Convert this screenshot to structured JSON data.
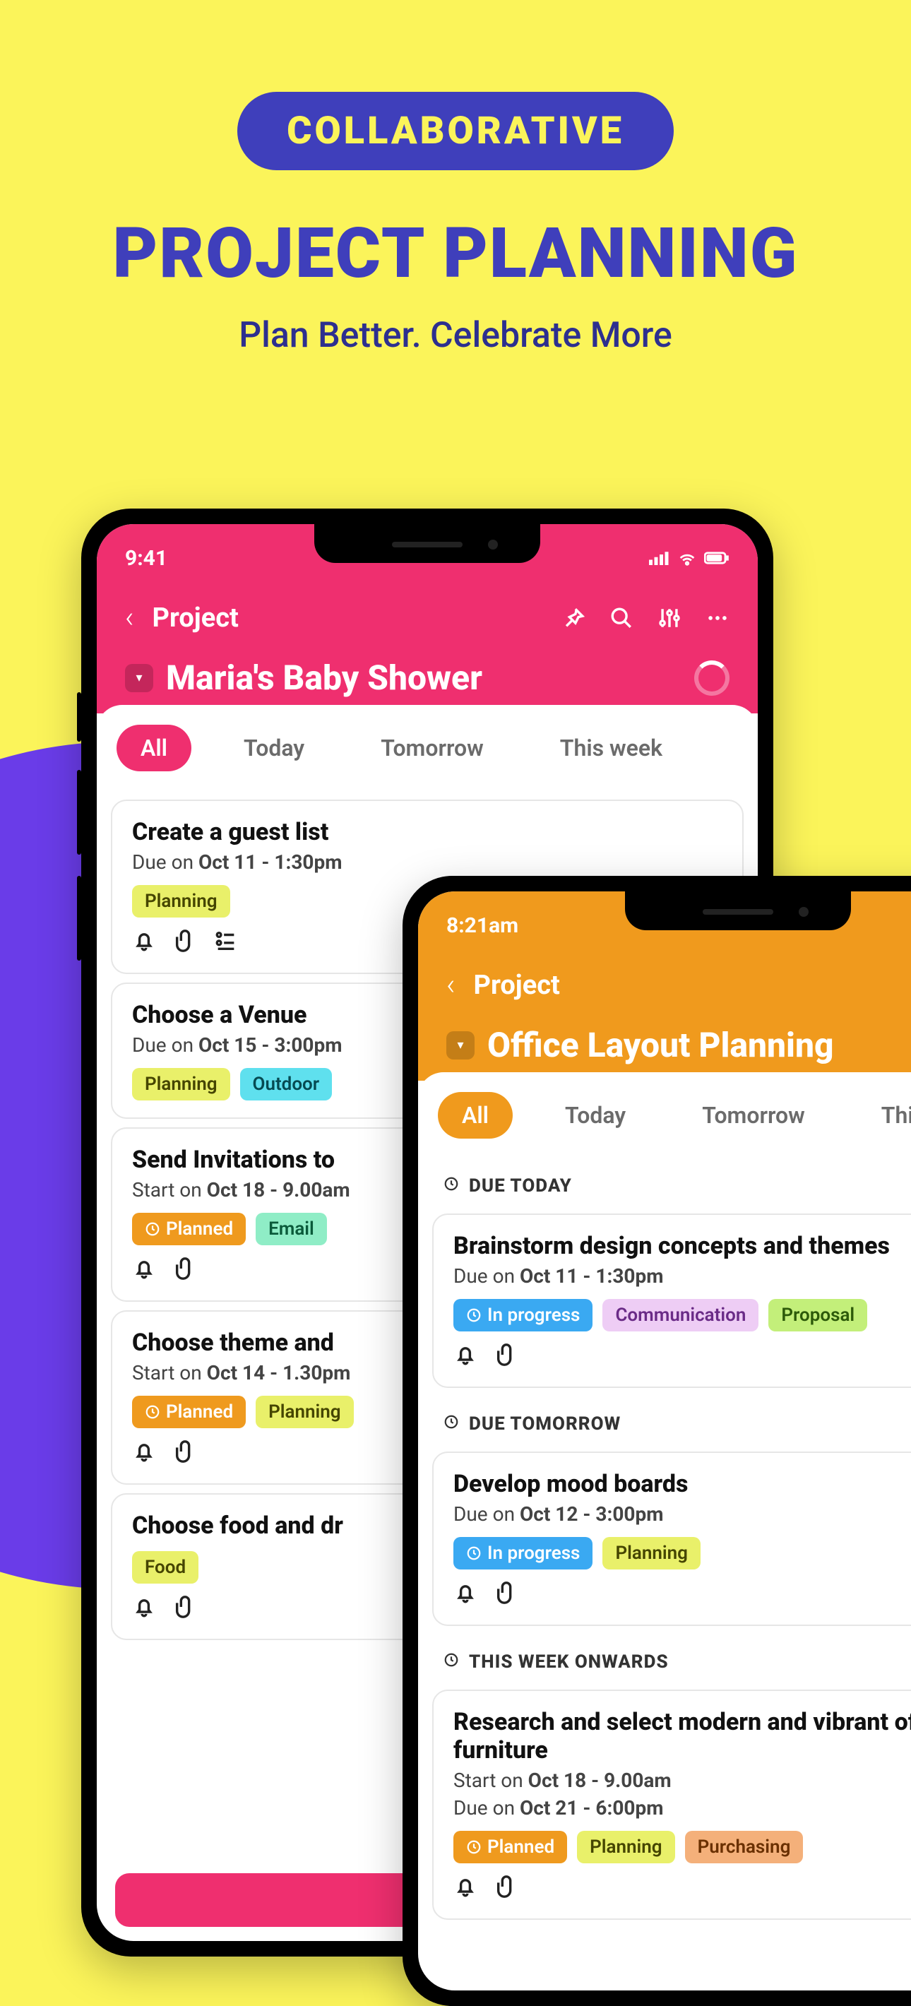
{
  "hero": {
    "pill": "COLLABORATIVE",
    "title": "PROJECT PLANNING",
    "tagline": "Plan Better. Celebrate More"
  },
  "phone1": {
    "time": "9:41",
    "nav_label": "Project",
    "title": "Maria's Baby Shower",
    "filters": {
      "all": "All",
      "today": "Today",
      "tomorrow": "Tomorrow",
      "week": "This week"
    },
    "tasks": [
      {
        "title": "Create a guest list",
        "meta_k": "Due on ",
        "meta_v": "Oct 11 - 1:30pm",
        "tags": [
          {
            "label": "Planning",
            "cls": "yellow"
          }
        ],
        "icons": [
          "bell",
          "clip",
          "list"
        ]
      },
      {
        "title": "Choose a Venue",
        "meta_k": "Due on ",
        "meta_v": "Oct 15 - 3:00pm",
        "tags": [
          {
            "label": "Planning",
            "cls": "yellow"
          },
          {
            "label": "Outdoor",
            "cls": "cyan"
          }
        ],
        "icons": []
      },
      {
        "title": "Send Invitations to",
        "meta_k": "Start on ",
        "meta_v": "Oct 18 - 9.00am",
        "tags": [
          {
            "label": "Planned",
            "cls": "orange",
            "clock": true
          },
          {
            "label": "Email",
            "cls": "mint"
          }
        ],
        "icons": [
          "bell",
          "clip"
        ]
      },
      {
        "title": "Choose theme and",
        "meta_k": "Start on ",
        "meta_v": "Oct 14 - 1.30pm",
        "tags": [
          {
            "label": "Planned",
            "cls": "orange",
            "clock": true
          },
          {
            "label": "Planning",
            "cls": "yellow"
          }
        ],
        "icons": [
          "bell",
          "clip"
        ]
      },
      {
        "title": "Choose food and dr",
        "meta_k": "",
        "meta_v": "",
        "tags": [
          {
            "label": "Food",
            "cls": "yellow"
          }
        ],
        "icons": [
          "bell",
          "clip"
        ]
      }
    ]
  },
  "phone2": {
    "time": "8:21am",
    "nav_label": "Project",
    "title": "Office Layout Planning",
    "filters": {
      "all": "All",
      "today": "Today",
      "tomorrow": "Tomorrow",
      "week": "This w"
    },
    "sections": [
      {
        "header": "DUE TODAY",
        "tasks": [
          {
            "title": "Brainstorm design concepts and themes",
            "lines": [
              {
                "k": "Due on ",
                "v": "Oct 11 - 1:30pm"
              }
            ],
            "tags": [
              {
                "label": "In progress",
                "cls": "blue",
                "clock": true
              },
              {
                "label": "Communication",
                "cls": "lilac"
              },
              {
                "label": "Proposal",
                "cls": "lime"
              }
            ],
            "icons": [
              "bell",
              "clip"
            ]
          }
        ]
      },
      {
        "header": "DUE TOMORROW",
        "tasks": [
          {
            "title": "Develop mood boards",
            "lines": [
              {
                "k": "Due on ",
                "v": "Oct 12 - 3:00pm"
              }
            ],
            "tags": [
              {
                "label": "In progress",
                "cls": "blue",
                "clock": true
              },
              {
                "label": "Planning",
                "cls": "yellow"
              }
            ],
            "icons": [
              "bell",
              "clip"
            ]
          }
        ]
      },
      {
        "header": "THIS WEEK ONWARDS",
        "tasks": [
          {
            "title": "Research and select modern and vibrant office furniture",
            "lines": [
              {
                "k": "Start on ",
                "v": "Oct 18 - 9.00am"
              },
              {
                "k": "Due on ",
                "v": "Oct 21 - 6:00pm"
              }
            ],
            "tags": [
              {
                "label": "Planned",
                "cls": "orange",
                "clock": true
              },
              {
                "label": "Planning",
                "cls": "yellow"
              },
              {
                "label": "Purchasing",
                "cls": "peach"
              }
            ],
            "icons": [
              "bell",
              "clip"
            ]
          }
        ]
      }
    ]
  }
}
